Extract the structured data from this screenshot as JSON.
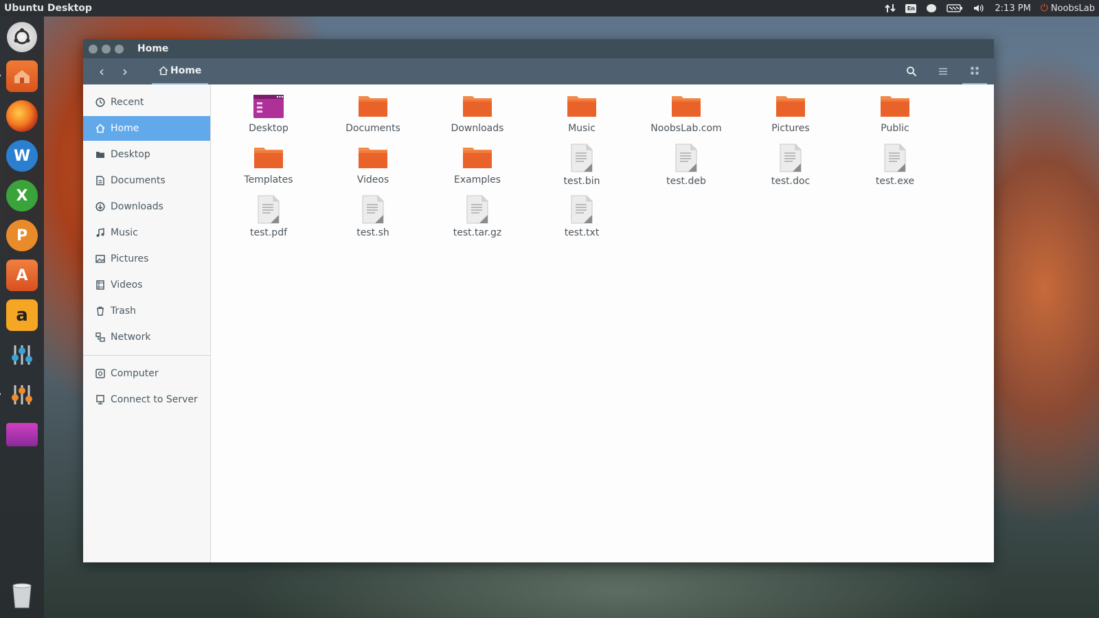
{
  "topbar": {
    "title": "Ubuntu Desktop",
    "keyboard_layout": "En",
    "time": "2:13 PM",
    "user": "NoobsLab",
    "icons": [
      "network-icon",
      "keyboard-icon",
      "messaging-icon",
      "battery-icon",
      "volume-icon",
      "power-icon"
    ]
  },
  "launcher": {
    "items": [
      "ubuntu-dash-icon",
      "files-icon",
      "firefox-icon",
      "writer-icon",
      "calc-icon",
      "impress-icon",
      "software-center-icon",
      "amazon-icon",
      "unity-tweak-icon",
      "settings-icon",
      "terminal-icon",
      "trash-icon"
    ]
  },
  "window": {
    "title": "Home",
    "path_label": "Home"
  },
  "sidebar": {
    "items": [
      {
        "label": "Recent",
        "icon": "clock-icon"
      },
      {
        "label": "Home",
        "icon": "home-icon"
      },
      {
        "label": "Desktop",
        "icon": "folder-icon"
      },
      {
        "label": "Documents",
        "icon": "document-icon"
      },
      {
        "label": "Downloads",
        "icon": "download-icon"
      },
      {
        "label": "Music",
        "icon": "music-icon"
      },
      {
        "label": "Pictures",
        "icon": "picture-icon"
      },
      {
        "label": "Videos",
        "icon": "video-icon"
      },
      {
        "label": "Trash",
        "icon": "trash-icon"
      },
      {
        "label": "Network",
        "icon": "network-icon"
      }
    ],
    "devices": [
      {
        "label": "Computer",
        "icon": "computer-icon"
      },
      {
        "label": "Connect to Server",
        "icon": "server-icon"
      }
    ]
  },
  "files": [
    {
      "name": "Desktop",
      "kind": "desktop-folder"
    },
    {
      "name": "Documents",
      "kind": "folder"
    },
    {
      "name": "Downloads",
      "kind": "folder"
    },
    {
      "name": "Music",
      "kind": "folder"
    },
    {
      "name": "NoobsLab.com",
      "kind": "folder"
    },
    {
      "name": "Pictures",
      "kind": "folder"
    },
    {
      "name": "Public",
      "kind": "folder"
    },
    {
      "name": "Templates",
      "kind": "folder"
    },
    {
      "name": "Videos",
      "kind": "folder"
    },
    {
      "name": "Examples",
      "kind": "folder"
    },
    {
      "name": "test.bin",
      "kind": "file"
    },
    {
      "name": "test.deb",
      "kind": "file"
    },
    {
      "name": "test.doc",
      "kind": "file"
    },
    {
      "name": "test.exe",
      "kind": "file"
    },
    {
      "name": "test.pdf",
      "kind": "file"
    },
    {
      "name": "test.sh",
      "kind": "file"
    },
    {
      "name": "test.tar.gz",
      "kind": "file"
    },
    {
      "name": "test.txt",
      "kind": "file"
    }
  ],
  "colors": {
    "accent": "#61a9ea",
    "folder_orange": "#e8622a",
    "header_bg": "#4f6170"
  }
}
